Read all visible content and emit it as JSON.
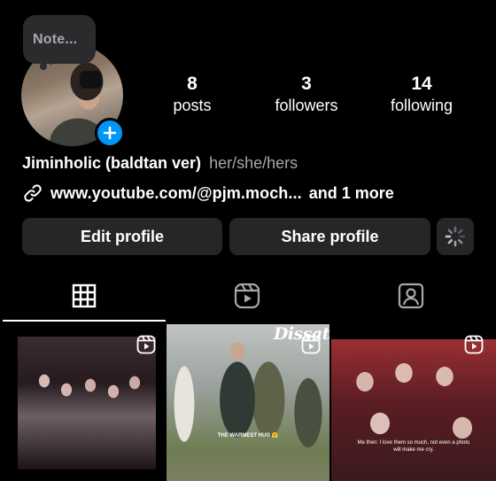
{
  "note": {
    "placeholder": "Note..."
  },
  "profile": {
    "name": "Jiminholic (baldtan ver)",
    "pronouns": "her/she/hers",
    "link": "www.youtube.com/@pjm.moch...",
    "link_more": "and 1 more"
  },
  "stats": [
    {
      "value": "8",
      "label": "posts"
    },
    {
      "value": "3",
      "label": "followers"
    },
    {
      "value": "14",
      "label": "following"
    }
  ],
  "buttons": {
    "edit": "Edit profile",
    "share": "Share profile"
  },
  "tabs": [
    {
      "icon": "grid-icon",
      "active": true
    },
    {
      "icon": "reels-icon",
      "active": false
    },
    {
      "icon": "tagged-icon",
      "active": false
    }
  ],
  "posts": [
    {
      "type": "reel"
    },
    {
      "type": "reel",
      "title": "Dissat",
      "caption": "THE WARMEST HUG 🤗"
    },
    {
      "type": "reel",
      "caption": "Me then: I love them so much, not even a photo will make me cry."
    }
  ],
  "colors": {
    "accent": "#0095f6",
    "button_bg": "#262628",
    "background": "#000000",
    "muted_text": "#a8a8ad"
  }
}
